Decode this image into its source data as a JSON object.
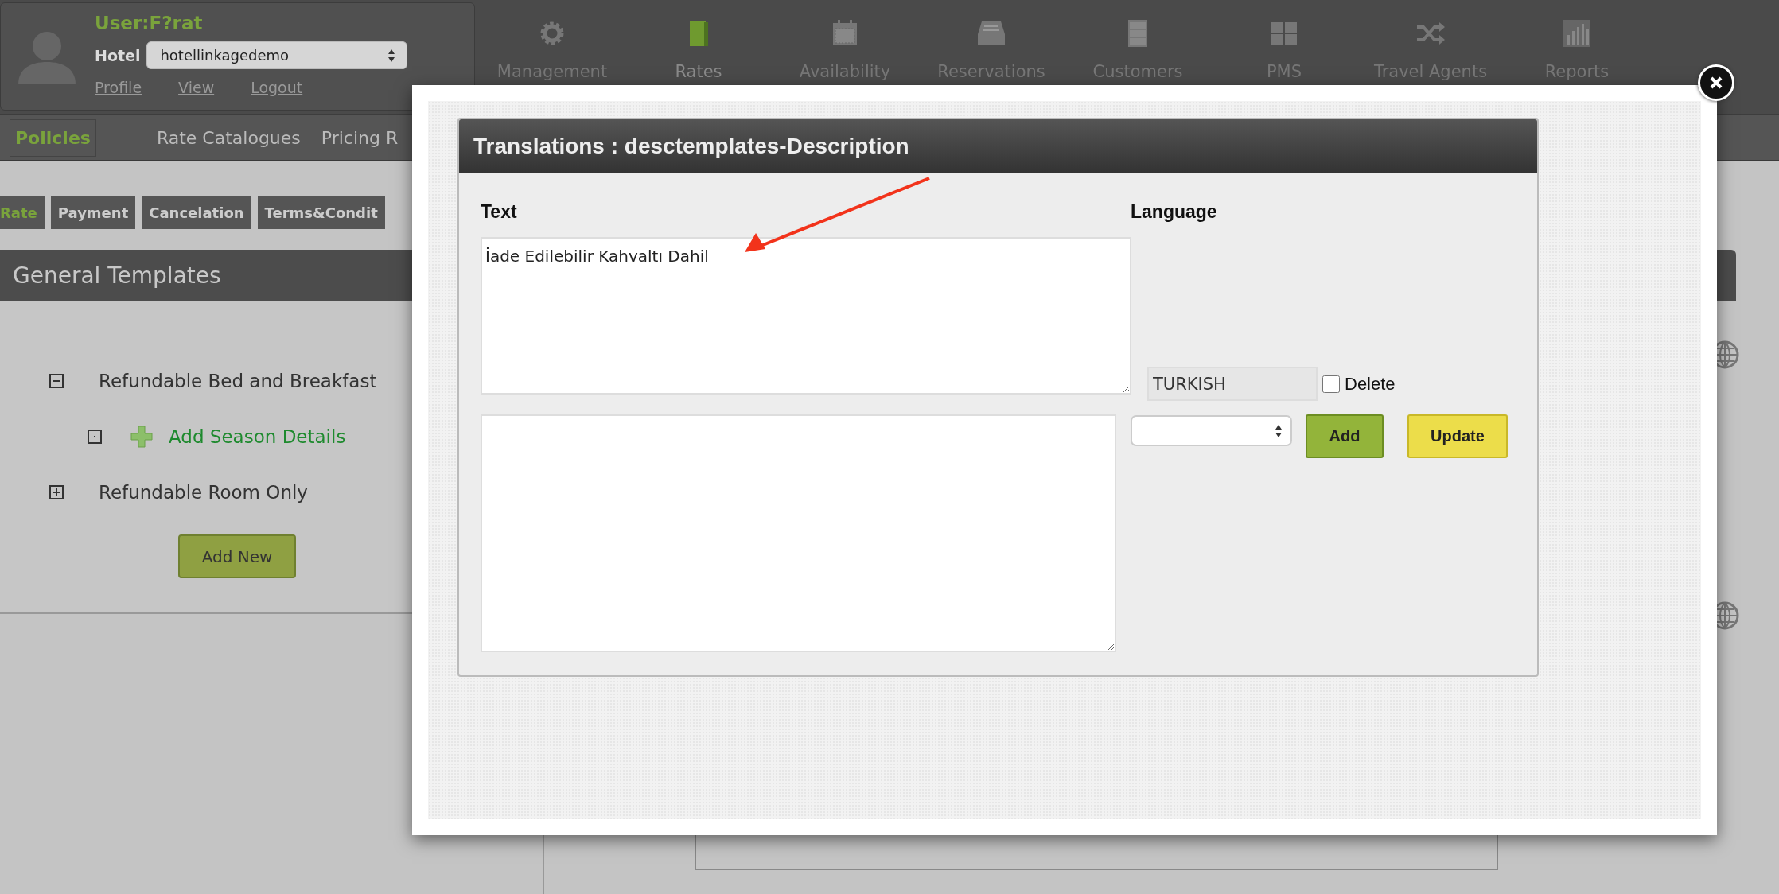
{
  "user_panel": {
    "user": "User:F?rat",
    "hotel_label": "Hotel",
    "hotel": "hotellinkagedemo",
    "links": [
      "Profile",
      "View",
      "Logout"
    ]
  },
  "main_nav": [
    {
      "label": "Management",
      "kind": "gear",
      "selected": false
    },
    {
      "label": "Rates",
      "kind": "book",
      "selected": true
    },
    {
      "label": "Availability",
      "kind": "calendar",
      "selected": false
    },
    {
      "label": "Reservations",
      "kind": "tray",
      "selected": false
    },
    {
      "label": "Customers",
      "kind": "cabinet",
      "selected": false
    },
    {
      "label": "PMS",
      "kind": "grid",
      "selected": false
    },
    {
      "label": "Travel Agents",
      "kind": "shuffle",
      "selected": false
    },
    {
      "label": "Reports",
      "kind": "chart",
      "selected": false
    }
  ],
  "sub_nav": [
    {
      "label": "Policies",
      "selected": true
    },
    {
      "label": "Rate Catalogues",
      "selected": false
    },
    {
      "label": "Pricing R",
      "selected": false
    }
  ],
  "tabs": [
    {
      "label": "Rate",
      "selected": true
    },
    {
      "label": "Payment",
      "selected": false
    },
    {
      "label": "Cancelation",
      "selected": false
    },
    {
      "label": "Terms&Condit",
      "selected": false
    }
  ],
  "section_title": "General Templates",
  "tree": [
    {
      "label": "Refundable Bed and Breakfast",
      "expanded": true,
      "children": [
        {
          "label": "Add Season Details",
          "kind": "add"
        }
      ]
    },
    {
      "label": "Refundable Room Only",
      "expanded": false
    }
  ],
  "add_button": "Add New",
  "modal": {
    "title": "Translations : desctemplates-Description",
    "text_label": "Text",
    "language_label": "Language",
    "entry": {
      "text": "İade Edilebilir Kahvaltı Dahil",
      "language": "TURKISH",
      "delete_label": "Delete",
      "delete_checked": false
    },
    "add_button": "Add",
    "update_button": "Update"
  }
}
